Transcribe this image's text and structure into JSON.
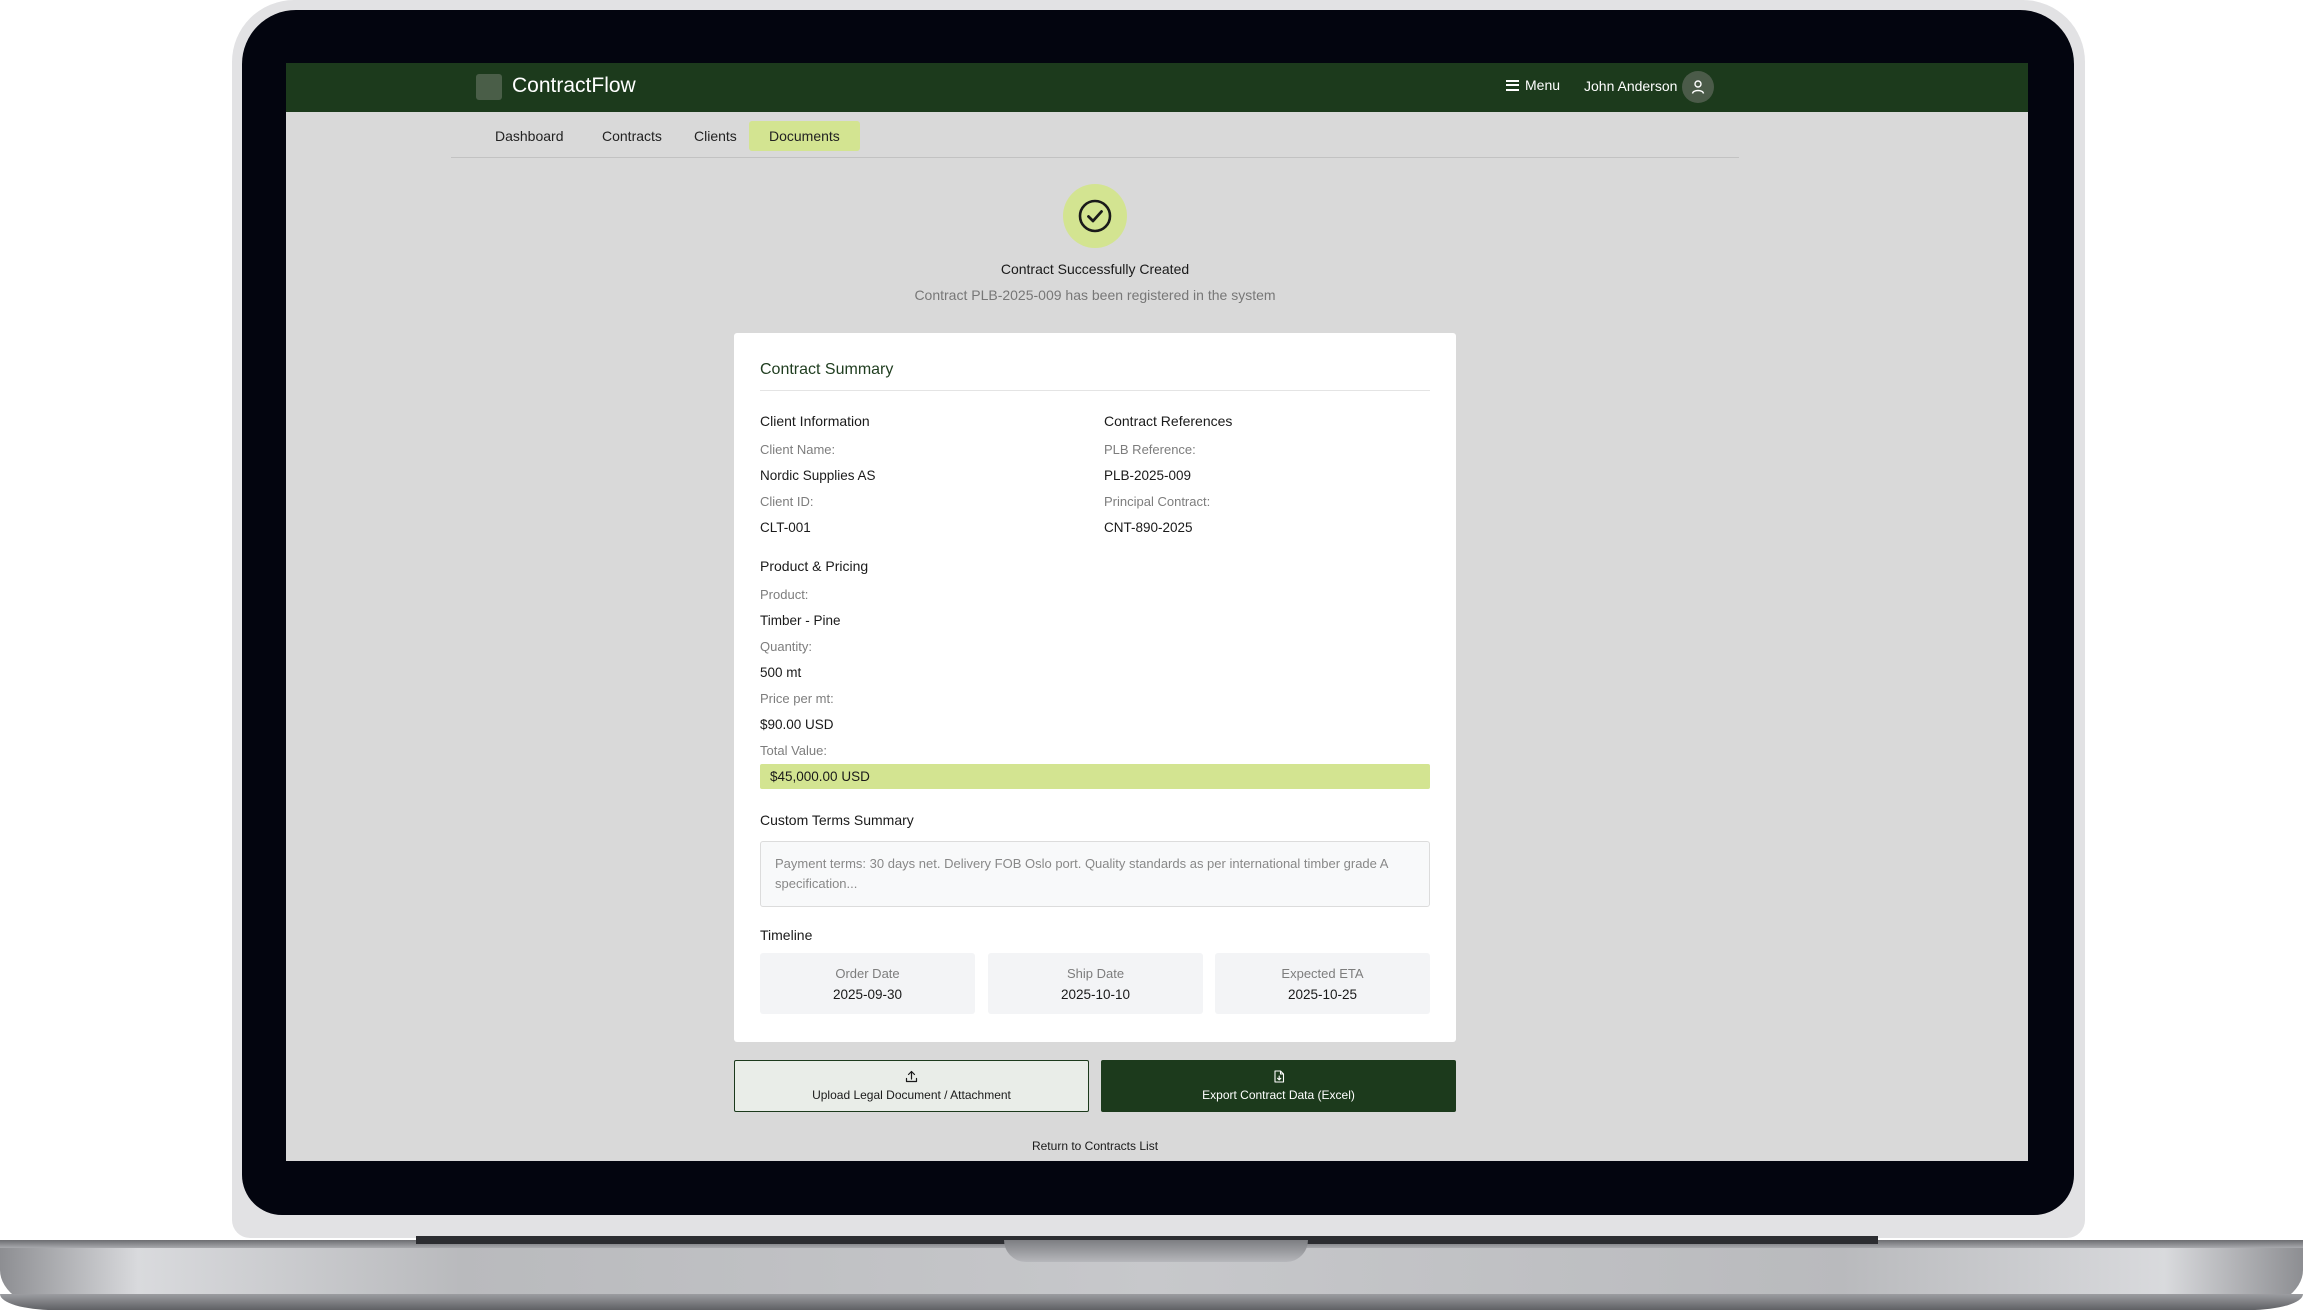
{
  "app": {
    "title": "ContractFlow",
    "menu_label": "Menu",
    "user_name": "John Anderson"
  },
  "tabs": [
    {
      "label": "Dashboard",
      "active": false
    },
    {
      "label": "Contracts",
      "active": false
    },
    {
      "label": "Clients",
      "active": false
    },
    {
      "label": "Documents",
      "active": true
    }
  ],
  "success": {
    "title": "Contract Successfully Created",
    "subtitle": "Contract PLB-2025-009 has been registered in the system"
  },
  "summary": {
    "title": "Contract Summary",
    "client_info": {
      "heading": "Client Information",
      "client_name_label": "Client Name:",
      "client_name": "Nordic Supplies AS",
      "client_id_label": "Client ID:",
      "client_id": "CLT-001"
    },
    "references": {
      "heading": "Contract References",
      "plb_label": "PLB Reference:",
      "plb_value": "PLB-2025-009",
      "principal_label": "Principal Contract:",
      "principal_value": "CNT-890-2025"
    },
    "pricing": {
      "heading": "Product & Pricing",
      "product_label": "Product:",
      "product": "Timber - Pine",
      "quantity_label": "Quantity:",
      "quantity": "500 mt",
      "price_label": "Price per mt:",
      "price": "$90.00 USD",
      "total_label": "Total Value:",
      "total": "$45,000.00 USD"
    },
    "terms": {
      "heading": "Custom Terms Summary",
      "text": "Payment terms: 30 days net. Delivery FOB Oslo port. Quality standards as per international timber grade A specification..."
    },
    "timeline": {
      "heading": "Timeline",
      "items": [
        {
          "label": "Order Date",
          "value": "2025-09-30"
        },
        {
          "label": "Ship Date",
          "value": "2025-10-10"
        },
        {
          "label": "Expected ETA",
          "value": "2025-10-25"
        }
      ]
    }
  },
  "actions": {
    "upload_label": "Upload Legal Document / Attachment",
    "export_label": "Export Contract Data (Excel)",
    "return_label": "Return to Contracts List"
  },
  "colors": {
    "brand_dark": "#1c3a1c",
    "accent_lime": "#d3e491",
    "screen_bg": "#d9d9d9"
  },
  "icons": {
    "logo": "logo-square-icon",
    "menu": "hamburger-icon",
    "avatar": "user-icon",
    "success": "check-circle-icon",
    "upload": "upload-icon",
    "export": "file-export-icon"
  }
}
